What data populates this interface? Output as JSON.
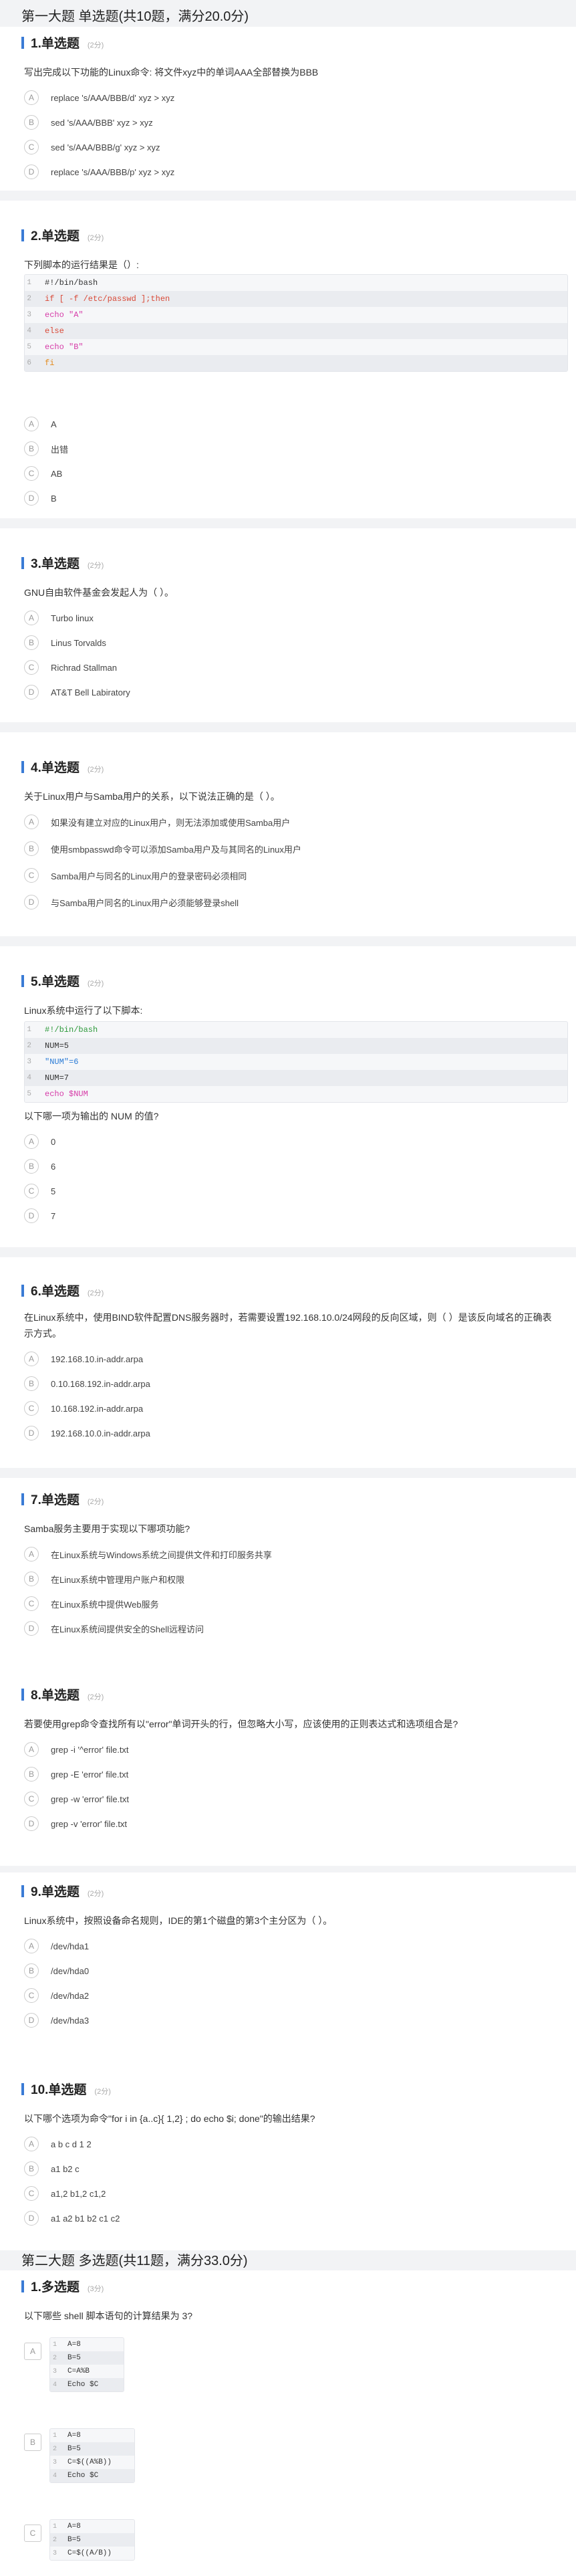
{
  "part1": {
    "title": "第一大题 单选题(共10题，满分20.0分)"
  },
  "part2": {
    "title": "第二大题 多选题(共11题，满分33.0分)"
  },
  "q1": {
    "num": "1.单选题",
    "score": "(2分)",
    "text": "写出完成以下功能的Linux命令: 将文件xyz中的单词AAA全部替换为BBB",
    "options": [
      {
        "key": "A",
        "text": "replace 's/AAA/BBB/d' xyz > xyz"
      },
      {
        "key": "B",
        "text": "sed 's/AAA/BBB' xyz > xyz"
      },
      {
        "key": "C",
        "text": "sed 's/AAA/BBB/g' xyz > xyz"
      },
      {
        "key": "D",
        "text": "replace 's/AAA/BBB/p' xyz > xyz"
      }
    ]
  },
  "q2": {
    "num": "2.单选题",
    "score": "(2分)",
    "text": "下列脚本的运行结果是（）:",
    "code": [
      "#!/bin/bash",
      "if [ -f /etc/passwd ];then",
      "  echo \"A\"",
      "else",
      "  echo \"B\"",
      "fi"
    ],
    "options": [
      {
        "key": "A",
        "text": "A"
      },
      {
        "key": "B",
        "text": "出错"
      },
      {
        "key": "C",
        "text": "AB"
      },
      {
        "key": "D",
        "text": "B"
      }
    ]
  },
  "q3": {
    "num": "3.单选题",
    "score": "(2分)",
    "text": "GNU自由软件基金会发起人为（ ）。",
    "options": [
      {
        "key": "A",
        "text": "Turbo linux"
      },
      {
        "key": "B",
        "text": "Linus Torvalds"
      },
      {
        "key": "C",
        "text": "Richrad Stallman"
      },
      {
        "key": "D",
        "text": "AT&T Bell Labiratory"
      }
    ]
  },
  "q4": {
    "num": "4.单选题",
    "score": "(2分)",
    "text": "关于Linux用户与Samba用户的关系，以下说法正确的是（    ）。",
    "options": [
      {
        "key": "A",
        "text": "如果没有建立对应的Linux用户，则无法添加或使用Samba用户"
      },
      {
        "key": "B",
        "text": "使用smbpasswd命令可以添加Samba用户及与其同名的Linux用户"
      },
      {
        "key": "C",
        "text": "Samba用户与同名的Linux用户的登录密码必须相同"
      },
      {
        "key": "D",
        "text": "与Samba用户同名的Linux用户必须能够登录shell"
      }
    ]
  },
  "q5": {
    "num": "5.单选题",
    "score": "(2分)",
    "text": "Linux系统中运行了以下脚本:",
    "text2": "以下哪一项为输出的 NUM 的值?",
    "code": [
      "#!/bin/bash",
      "NUM=5",
      "\"NUM\"=6",
      "NUM=7",
      "echo $NUM"
    ],
    "options": [
      {
        "key": "A",
        "text": "0"
      },
      {
        "key": "B",
        "text": "6"
      },
      {
        "key": "C",
        "text": "5"
      },
      {
        "key": "D",
        "text": "7"
      }
    ]
  },
  "q6": {
    "num": "6.单选题",
    "score": "(2分)",
    "text": "在Linux系统中，使用BIND软件配置DNS服务器时，若需要设置192.168.10.0/24网段的反向区域，则（    ）是该反向域名的正确表示方式。",
    "options": [
      {
        "key": "A",
        "text": "192.168.10.in-addr.arpa"
      },
      {
        "key": "B",
        "text": "0.10.168.192.in-addr.arpa"
      },
      {
        "key": "C",
        "text": "10.168.192.in-addr.arpa"
      },
      {
        "key": "D",
        "text": "192.168.10.0.in-addr.arpa"
      }
    ]
  },
  "q7": {
    "num": "7.单选题",
    "score": "(2分)",
    "text": "Samba服务主要用于实现以下哪项功能?",
    "options": [
      {
        "key": "A",
        "text": "在Linux系统与Windows系统之间提供文件和打印服务共享"
      },
      {
        "key": "B",
        "text": "在Linux系统中管理用户账户和权限"
      },
      {
        "key": "C",
        "text": "在Linux系统中提供Web服务"
      },
      {
        "key": "D",
        "text": "在Linux系统间提供安全的Shell远程访问"
      }
    ]
  },
  "q8": {
    "num": "8.单选题",
    "score": "(2分)",
    "text": "若要使用grep命令查找所有以\"error\"单词开头的行，但忽略大小写，应该使用的正则表达式和选项组合是?",
    "options": [
      {
        "key": "A",
        "text": "grep -i '^error' file.txt"
      },
      {
        "key": "B",
        "text": "grep -E 'error' file.txt"
      },
      {
        "key": "C",
        "text": "grep -w 'error' file.txt"
      },
      {
        "key": "D",
        "text": "grep -v 'error' file.txt"
      }
    ]
  },
  "q9": {
    "num": "9.单选题",
    "score": "(2分)",
    "text": "Linux系统中，按照设备命名规则，IDE的第1个磁盘的第3个主分区为（    ）。",
    "options": [
      {
        "key": "A",
        "text": "/dev/hda1"
      },
      {
        "key": "B",
        "text": "/dev/hda0"
      },
      {
        "key": "C",
        "text": "/dev/hda2"
      },
      {
        "key": "D",
        "text": "/dev/hda3"
      }
    ]
  },
  "q10": {
    "num": "10.单选题",
    "score": "(2分)",
    "text": "以下哪个选项为命令\"for i in {a..c}{ 1,2} ; do echo $i; done\"的输出结果?",
    "options": [
      {
        "key": "A",
        "text": "a b c d 1 2"
      },
      {
        "key": "B",
        "text": "a1 b2 c"
      },
      {
        "key": "C",
        "text": "a1,2 b1,2 c1,2"
      },
      {
        "key": "D",
        "text": "a1 a2 b1 b2 c1 c2"
      }
    ]
  },
  "m1": {
    "num": "1.多选题",
    "score": "(3分)",
    "text": "以下哪些 shell 脚本语句的计算结果为 3?",
    "options": [
      {
        "key": "A",
        "code": [
          "A=8",
          "B=5",
          "C=A%B",
          "Echo $C"
        ]
      },
      {
        "key": "B",
        "code": [
          "A=8",
          "B=5",
          "C=$((A%B))",
          "Echo $C"
        ]
      },
      {
        "key": "C",
        "code": [
          "A=8",
          "B=5",
          "C=$((A/B))"
        ]
      }
    ]
  }
}
